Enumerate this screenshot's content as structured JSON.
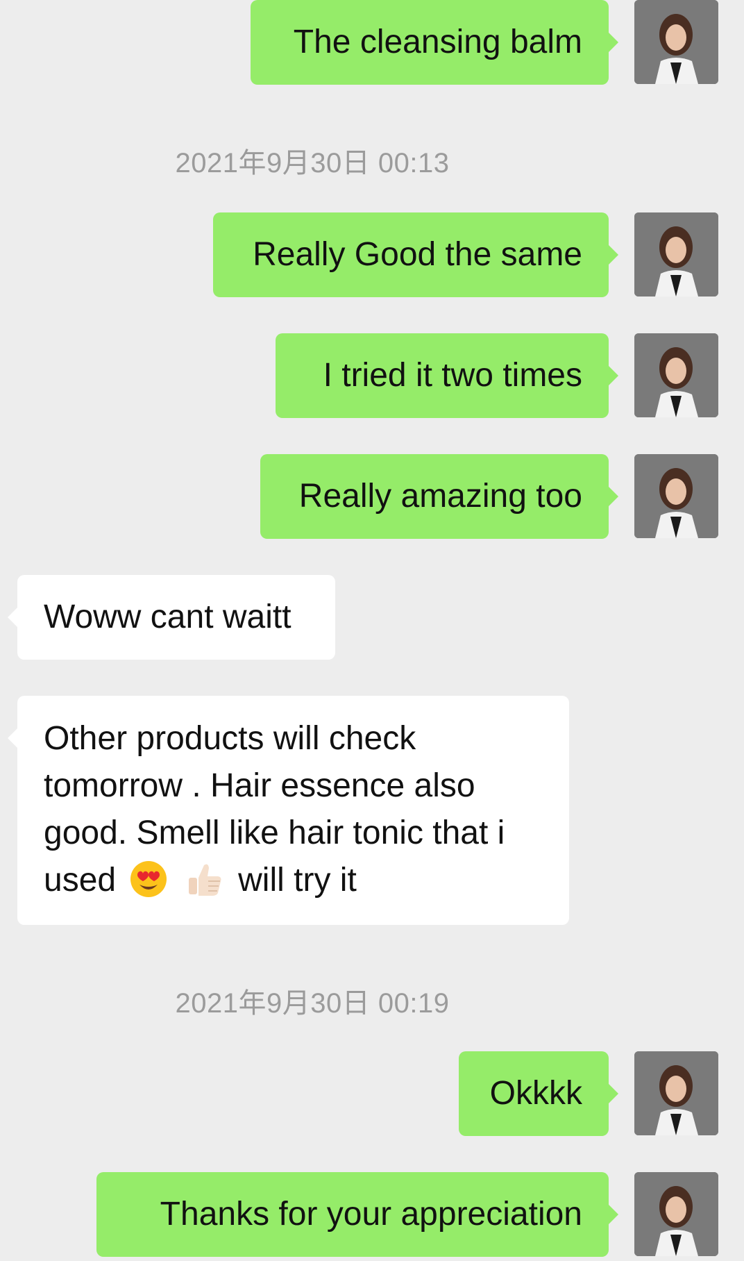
{
  "messages": [
    {
      "side": "out",
      "text": "The cleansing balm"
    },
    {
      "side": "out",
      "text": "Really Good the same"
    },
    {
      "side": "out",
      "text": "I tried it two times"
    },
    {
      "side": "out",
      "text": "Really amazing too"
    },
    {
      "side": "in",
      "text": "Woww cant waitt"
    },
    {
      "side": "in",
      "line1": "Other products will check",
      "line2": "tomorrow . Hair essence also",
      "line3": "good. Smell like hair tonic that i",
      "line4_before": "used",
      "line4_after": "will try it",
      "emojis": [
        "heart-eyes-emoji",
        "thumbs-up-emoji"
      ]
    },
    {
      "side": "out",
      "text": "Okkkk"
    },
    {
      "side": "out",
      "text": "Thanks for your appreciation"
    }
  ],
  "timestamps": [
    "2021年9月30日 00:13",
    "2021年9月30日 00:19"
  ],
  "colors": {
    "background": "#ededed",
    "outgoing_bubble": "#95ec69",
    "incoming_bubble": "#ffffff",
    "timestamp_text": "#9b9b9b"
  }
}
